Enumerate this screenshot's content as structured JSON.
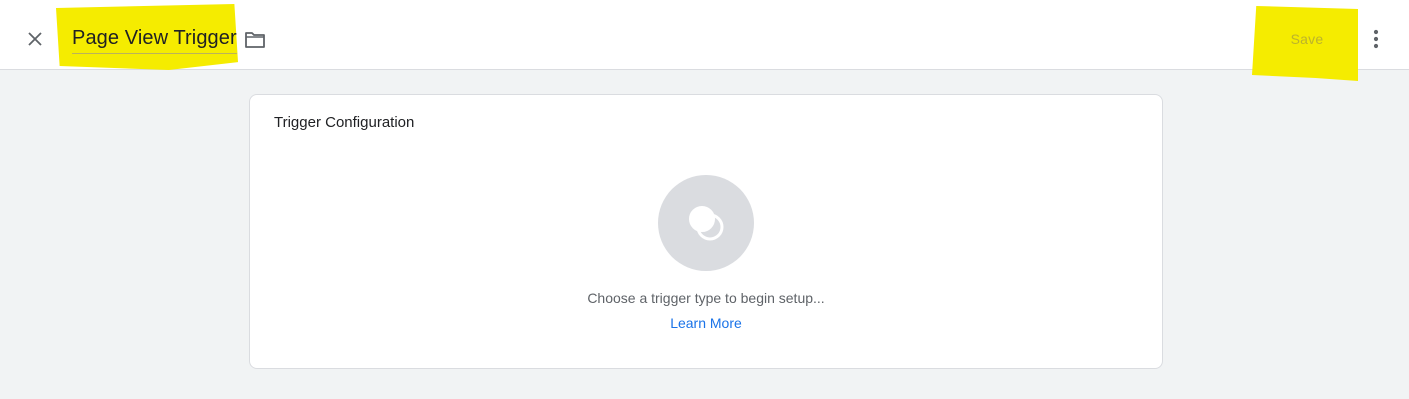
{
  "header": {
    "title": "Page View Trigger",
    "save_label": "Save",
    "highlight_color": "#f5ec00",
    "icons": {
      "close": "close-icon",
      "folder": "folder-icon",
      "more": "more-vert-icon"
    }
  },
  "card": {
    "title": "Trigger Configuration",
    "hint": "Choose a trigger type to begin setup...",
    "learn_more": "Learn More",
    "link_color": "#1a73e8",
    "icon": "trigger-type-icon"
  }
}
